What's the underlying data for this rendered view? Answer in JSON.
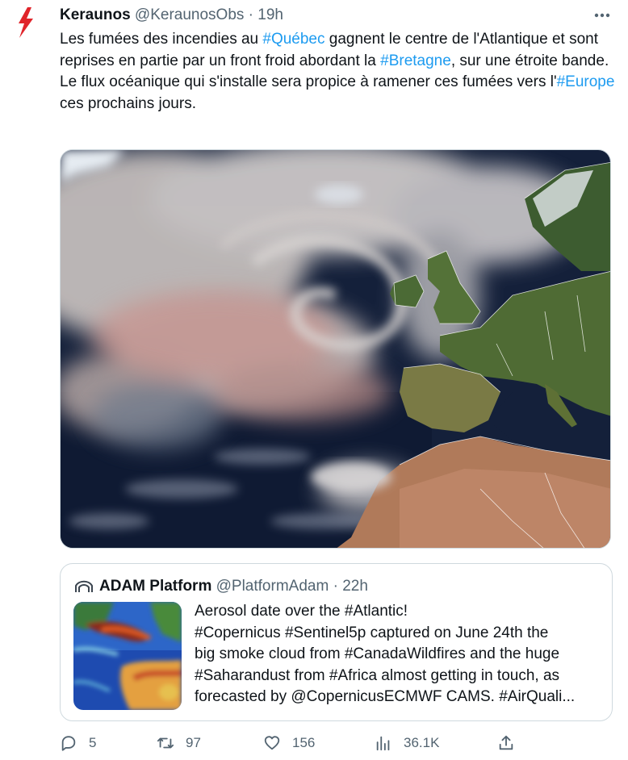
{
  "author": {
    "name": "Keraunos",
    "handle": "@KeraunosObs",
    "separator": "·",
    "time": "19h",
    "avatar_icon": "lightning-bolt-icon"
  },
  "more_icon": "more-dots-icon",
  "tweet_text": {
    "para1": {
      "t1": "Les fumées des incendies au ",
      "tag1": "#Québec",
      "t2": " gagnent le centre de l'Atlantique et sont reprises en partie par un front froid abordant la ",
      "tag2": "#Bretagne",
      "t3": ", sur une étroite bande."
    },
    "para2": {
      "t1": "Le flux océanique qui s'installe sera propice à ramener ces fumées vers l'",
      "tag1": "#Europe",
      "t2": " ces prochains jours."
    }
  },
  "quoted": {
    "name": "ADAM Platform",
    "handle": "@PlatformAdam",
    "separator": "·",
    "time": "22h",
    "avatar_icon": "platform-logo-icon",
    "lines": [
      "Aerosol date over the #Atlantic!",
      "#Copernicus #Sentinel5p captured on June 24th the",
      "big smoke cloud from #CanadaWildfires and the huge",
      "#Saharandust from #Africa almost getting in touch, as",
      "forecasted by @CopernicusECMWF CAMS. #AirQuali..."
    ]
  },
  "actions": {
    "replies": "5",
    "retweets": "97",
    "likes": "156",
    "views": "36.1K",
    "reply_icon": "reply-icon",
    "retweet_icon": "retweet-icon",
    "like_icon": "heart-icon",
    "views_icon": "analytics-icon",
    "share_icon": "share-icon"
  },
  "colors": {
    "link": "#1d9bf0",
    "secondary": "#536471",
    "border": "#cfd9de",
    "brand_red": "#e0242a"
  }
}
